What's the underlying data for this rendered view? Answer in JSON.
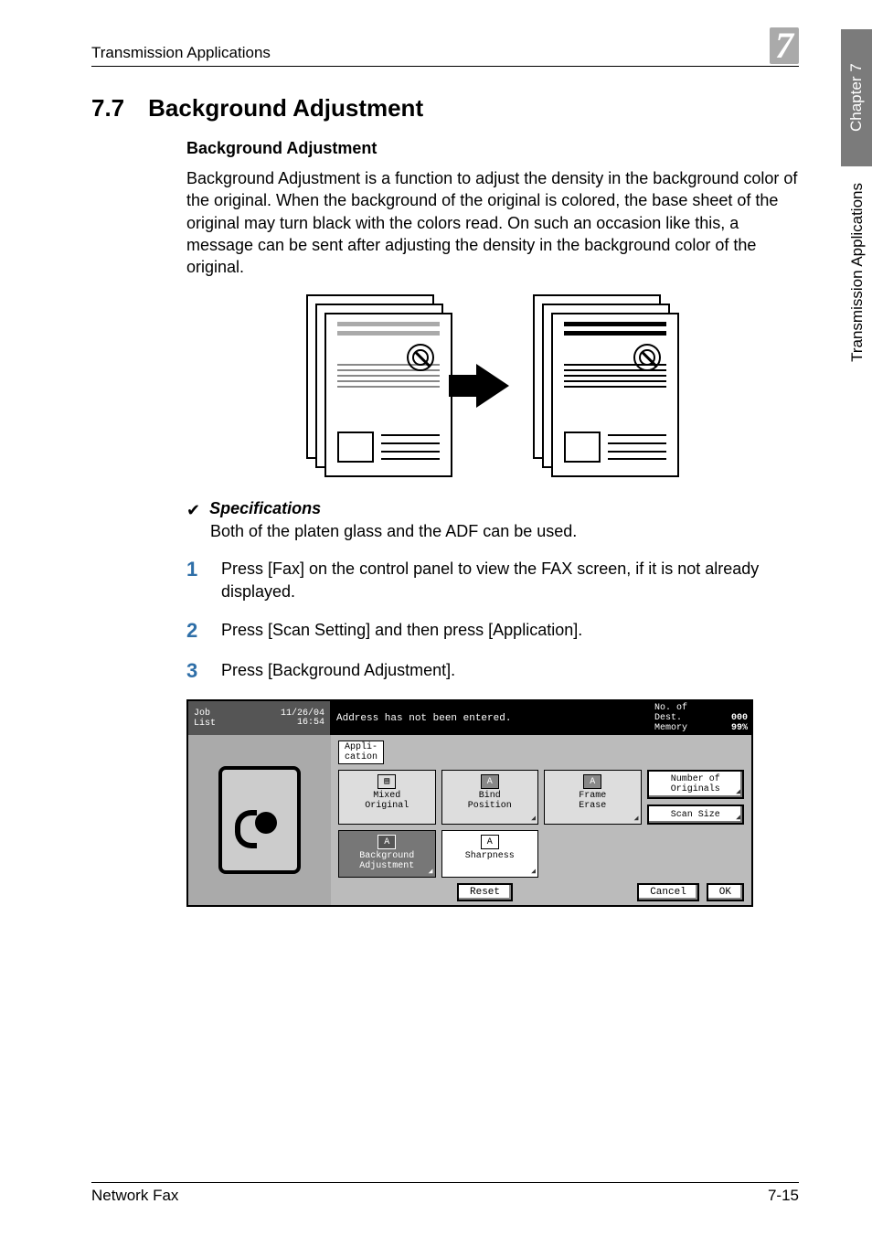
{
  "header": {
    "left": "Transmission Applications",
    "right": "7"
  },
  "side": {
    "chapter": "Chapter 7",
    "section": "Transmission Applications"
  },
  "section": {
    "number": "7.7",
    "title": "Background Adjustment"
  },
  "subhead": "Background Adjustment",
  "paragraph": "Background Adjustment is a function to adjust the density in the background color of the original. When the background of the original is colored, the base sheet of the original may turn black with the colors read. On such an occasion like this, a message can be sent after adjusting the density in the background color of the original.",
  "spec": {
    "check": "✔",
    "title": "Specifications",
    "text": "Both of the platen glass and the ADF can be used."
  },
  "steps": {
    "s1": {
      "n": "1",
      "t": "Press [Fax] on the control panel to view the FAX screen, if it is not already displayed."
    },
    "s2": {
      "n": "2",
      "t": "Press [Scan Setting] and then press [Application]."
    },
    "s3": {
      "n": "3",
      "t": "Press [Background Adjustment]."
    }
  },
  "ui": {
    "joblist": "Job\nList",
    "datetime": "11/26/04\n16:54",
    "banner": "Address has not been entered.",
    "dest_label": "No. of\nDest.",
    "dest_count": "000",
    "memory_label": "Memory",
    "memory_pct": "99%",
    "tab": "Appli-\ncation",
    "tiles": {
      "mixed": "Mixed\nOriginal",
      "bind": "Bind\nPosition",
      "frame": "Frame\nErase",
      "numorig": "Number of\nOriginals",
      "scansize": "Scan Size",
      "bgadj": "Background\nAdjustment",
      "sharp": "Sharpness"
    },
    "icon_a_bold": "A",
    "icon_a_plain": "A",
    "reset": "Reset",
    "cancel": "Cancel",
    "ok": "OK"
  },
  "footer": {
    "left": "Network Fax",
    "right": "7-15"
  }
}
